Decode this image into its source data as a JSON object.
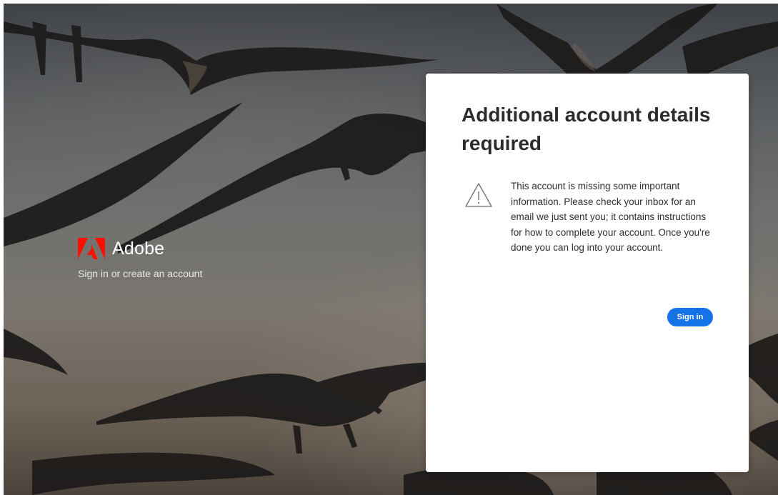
{
  "background": {
    "description_icon": "flying-birds-photo"
  },
  "brand": {
    "logo_icon": "adobe-logo-icon",
    "logo_color": "#fa0f00",
    "name": "Adobe",
    "tagline": "Sign in or create an account"
  },
  "card": {
    "title": "Additional account details required",
    "warning_icon": "warning-triangle-icon",
    "message": "This account is missing some important information. Please check your inbox for an email we just sent you; it contains instructions for how to complete your account. Once you're done you can log into your account.",
    "signin_label": "Sign in",
    "accent": "#1473e6"
  }
}
